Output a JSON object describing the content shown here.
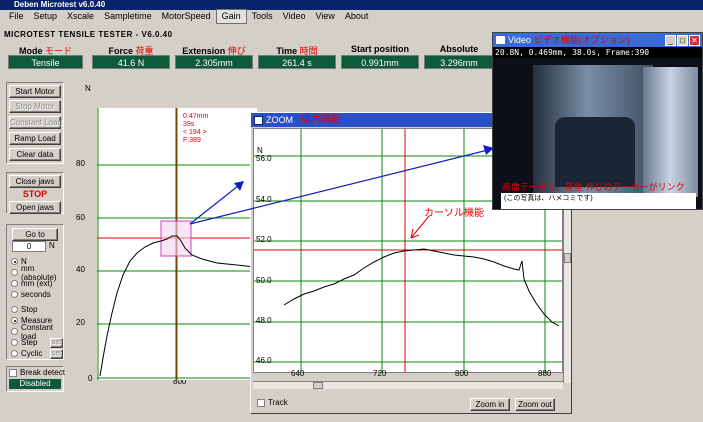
{
  "window": {
    "title": "Deben Microtest v6.0.40"
  },
  "menu": [
    "File",
    "Setup",
    "Xscale",
    "Sampletime",
    "MotorSpeed",
    "Gain",
    "Tools",
    "Video",
    "View",
    "About"
  ],
  "menu_active": "Gain",
  "app_title": "MICROTEST TENSILE TESTER - V6.0.40",
  "readouts": [
    {
      "label": "Mode",
      "jp": "モード",
      "value": "Tensile"
    },
    {
      "label": "Force",
      "jp": "荷重",
      "value": "41.6 N"
    },
    {
      "label": "Extension",
      "jp": "伸び",
      "value": "2.305mm"
    },
    {
      "label": "Time",
      "jp": "時間",
      "value": "261.4 s"
    },
    {
      "label": "Start position",
      "jp": "",
      "value": "0.991mm"
    },
    {
      "label": "Absolute position",
      "jp": "",
      "value": "3.296mm"
    }
  ],
  "buttons": {
    "start_motor": "Start Motor",
    "stop_motor": "Stop Motor",
    "constant_load": "Constant Load",
    "ramp_load": "Ramp Load",
    "clear_data": "Clear data",
    "close_jaws": "Close jaws",
    "stop": "STOP",
    "open_jaws": "Open jaws",
    "go_to": "Go to",
    "goto_value": "0",
    "goto_unit": "N",
    "set": "set",
    "zoom_in": "Zoom in",
    "zoom_out": "Zoom out"
  },
  "units_radio": [
    "N",
    "mm (absolute)",
    "mm (ext)",
    "seconds"
  ],
  "mode_radio": [
    "Stop",
    "Measure",
    "Constant load",
    "Step",
    "Cyclic"
  ],
  "break_detect": {
    "label": "Break detect",
    "status": "Disabled"
  },
  "main_plot": {
    "y_unit": "N",
    "y_ticks": [
      "80",
      "60",
      "40",
      "20",
      "0"
    ],
    "x_ticks": [
      "800"
    ],
    "cursor_label": [
      "0.47mm",
      "39s",
      "< 194 >",
      "F:389"
    ]
  },
  "zoom_window": {
    "title": "ZOOM",
    "title_jp": "拡大機能",
    "y_unit": "N",
    "y_ticks": [
      "56.0",
      "54.0",
      "52.0",
      "50.0",
      "48.0",
      "46.0"
    ],
    "x_ticks": [
      "640",
      "720",
      "800",
      "880"
    ],
    "track_label": "Track",
    "cursor_annotation": "カーソル機能"
  },
  "video_window": {
    "title": "Video",
    "title_jp": "ビデオ機能(オプション)",
    "overlay": "20.8N, 0.469mm, 38.0s, Frame:390",
    "caption_main": "画像データと、荷重-伸びのデーターがリンク",
    "caption_sub": "(この写真は、ハメコミです)"
  },
  "colors": {
    "readout_bg": "#0d5a3a",
    "grid": "#0a8a0a",
    "cursor": "#e00000",
    "annotation": "#e00000",
    "arrow": "#1020c0",
    "title_blue": "#0a246a"
  }
}
